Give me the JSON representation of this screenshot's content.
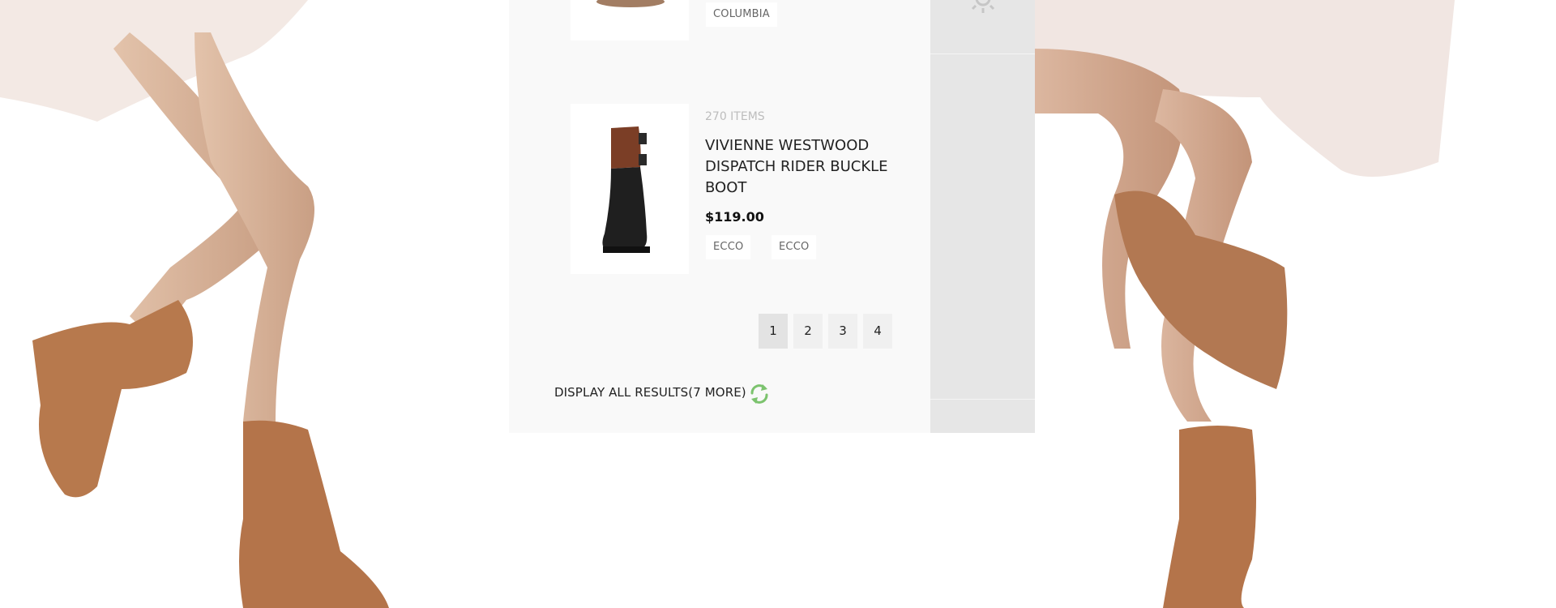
{
  "background": {
    "description_icon": "fashion-photo"
  },
  "top_item": {
    "tags": [
      "COLUMBIA"
    ]
  },
  "product": {
    "items_count": "270 ITEMS",
    "title_lines": [
      "VIVIENNE WESTWOOD",
      "DISPATCH RIDER BUCKLE",
      "BOOT"
    ],
    "price": "$119.00",
    "tags": [
      "ECCO",
      "ECCO"
    ]
  },
  "pagination": {
    "pages": [
      "1",
      "2",
      "3",
      "4"
    ],
    "current": "1"
  },
  "display_all": {
    "label": "DISPLAY ALL RESULTS(7 MORE)",
    "icon": "refresh-icon",
    "icon_color": "#7cc36e"
  },
  "side_panel": {
    "icon": "gear-icon"
  }
}
